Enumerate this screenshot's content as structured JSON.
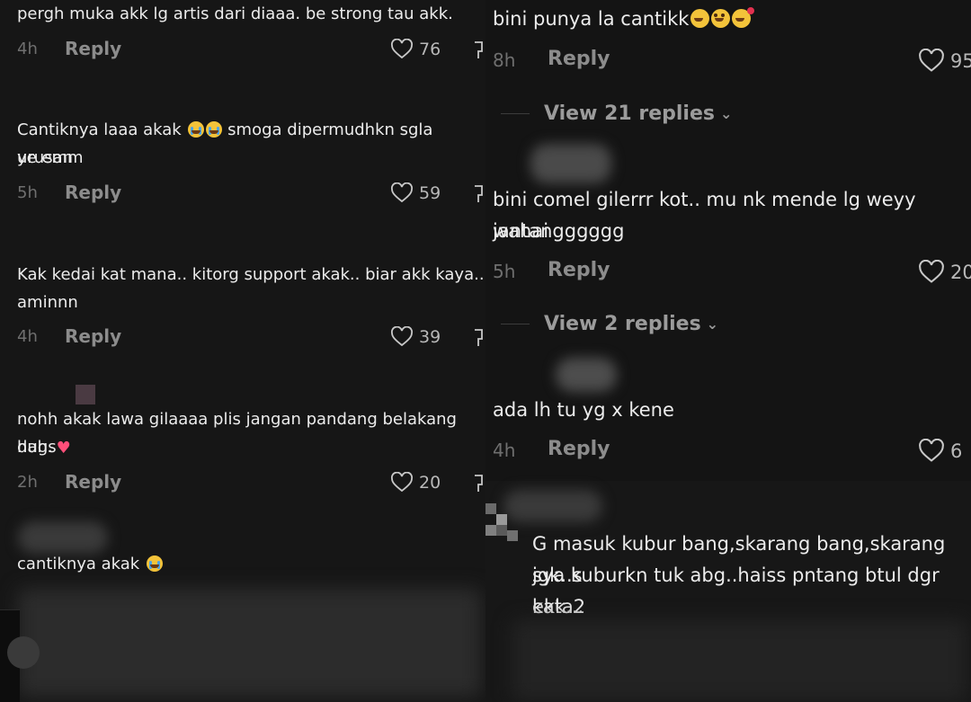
{
  "reply_label": "Reply",
  "left_comments": [
    {
      "text": "pergh muka akk lg artis dari diaaa. be strong tau akk.",
      "time": "4h",
      "likes": "76",
      "emojis": []
    },
    {
      "text": "Cantiknya laaa akak",
      "text2": " smoga dipermudhkn sgla urusan",
      "line2": "ye emm",
      "time": "5h",
      "likes": "59",
      "emojis": [
        "cry",
        "cry"
      ]
    },
    {
      "text": "Kak kedai kat mana.. kitorg support akak.. biar akk kaya..",
      "line2": "aminnn",
      "time": "4h",
      "likes": "39"
    },
    {
      "text": "nohh akak lawa gilaaaa plis jangan pandang belakang dah.",
      "line2": "hugs",
      "time": "2h",
      "likes": "20"
    },
    {
      "text": "cantiknya akak"
    }
  ],
  "right_comments": [
    {
      "text": "bini punya la cantikk",
      "time": "8h",
      "likes": "95"
    },
    {
      "view_replies": "View 21 replies"
    },
    {
      "text": "bini comel gilerrr kot.. mu nk mende lg weyy wahai",
      "line2": "jantangggggg",
      "time": "5h",
      "likes": "20"
    },
    {
      "view_replies": "View 2 replies"
    },
    {
      "text": "ada lh tu yg x kene",
      "time": "4h",
      "likes": "6"
    },
    {
      "text": "G masuk kubur bang,skarang bang,skarang jgk..s",
      "line2": "sya kuburkn tuk abg..haiss pntang btul dgr kata2",
      "line3": "ekk..."
    }
  ],
  "colors": {
    "background": "#161616",
    "text": "#ececec",
    "muted": "#6f6f6f",
    "reply": "#8c8c8c"
  }
}
